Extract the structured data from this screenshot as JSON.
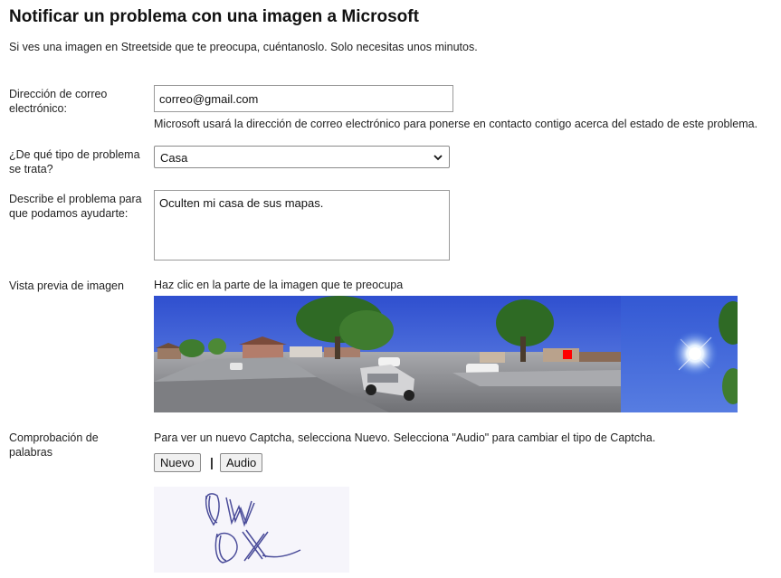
{
  "page": {
    "title": "Notificar un problema con una imagen a Microsoft",
    "intro": "Si ves una imagen en Streetside que te preocupa, cuéntanoslo. Solo necesitas unos minutos."
  },
  "email": {
    "label": "Dirección de correo electrónico:",
    "value": "correo@gmail.com",
    "hint": "Microsoft usará la dirección de correo electrónico para ponerse en contacto contigo acerca del estado de este problema."
  },
  "problem_type": {
    "label": "¿De qué tipo de problema se trata?",
    "selected": "Casa"
  },
  "description": {
    "label": "Describe el problema para que podamos ayudarte:",
    "value": "Oculten mi casa de sus mapas."
  },
  "preview": {
    "label": "Vista previa de imagen",
    "instruction": "Haz clic en la parte de la imagen que te preocupa"
  },
  "captcha": {
    "label": "Comprobación de palabras",
    "instruction": "Para ver un nuevo Captcha, selecciona Nuevo. Selecciona \"Audio\" para cambiar el tipo de Captcha.",
    "new_button": "Nuevo",
    "separator": "|",
    "audio_button": "Audio",
    "text": "PWDX"
  },
  "colors": {
    "sky": "#3f62d8",
    "grass": "#3c7a2c",
    "road": "#8e8f93",
    "marker": "#ff0000"
  }
}
